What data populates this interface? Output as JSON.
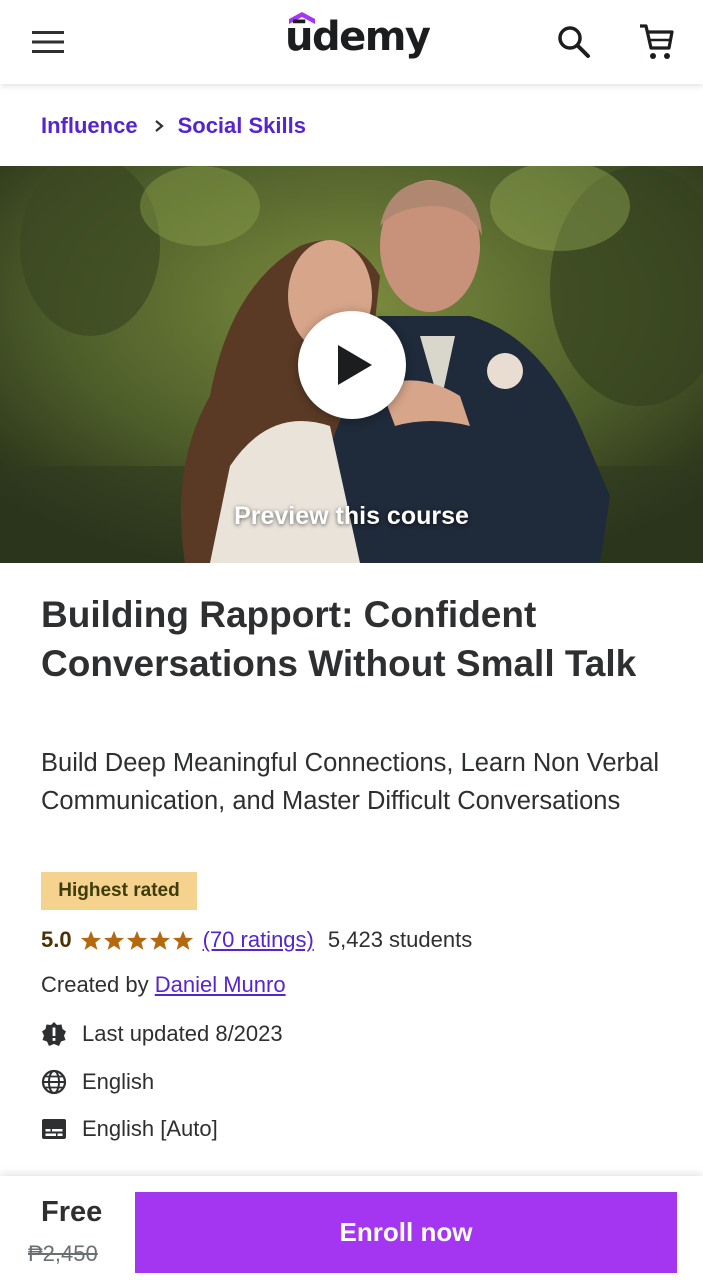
{
  "header": {
    "logo_text": "ūdemy",
    "menu_icon": "hamburger-menu-icon",
    "search_icon": "search-icon",
    "cart_icon": "cart-icon",
    "logo_accent_color": "#a435f0"
  },
  "breadcrumb": {
    "items": [
      {
        "label": "Influence"
      },
      {
        "label": "Social Skills"
      }
    ],
    "separator_icon": "chevron-right-icon",
    "color": "#5624d0"
  },
  "preview": {
    "label": "Preview this course",
    "play_icon": "play-icon"
  },
  "course": {
    "title": "Building Rapport: Confident Conversations Without Small Talk",
    "subtitle": "Build Deep Meaningful Connections, Learn Non Verbal Communication, and Master Difficult Conversations",
    "badge": "Highest rated",
    "rating": "5.0",
    "stars": 5,
    "ratings_link": "(70 ratings)",
    "students": "5,423 students",
    "created_prefix": "Created by",
    "author": "Daniel Munro",
    "last_updated": "Last updated 8/2023",
    "language": "English",
    "captions": "English [Auto]",
    "icons": {
      "updated": "alert-badge-icon",
      "language": "globe-icon",
      "captions": "closed-captions-icon"
    },
    "star_color": "#b4690e",
    "badge_color": "#f6d28f"
  },
  "purchase": {
    "price": "Free",
    "original_price": "₱2,450",
    "enroll_label": "Enroll now",
    "button_color": "#a435f0"
  }
}
